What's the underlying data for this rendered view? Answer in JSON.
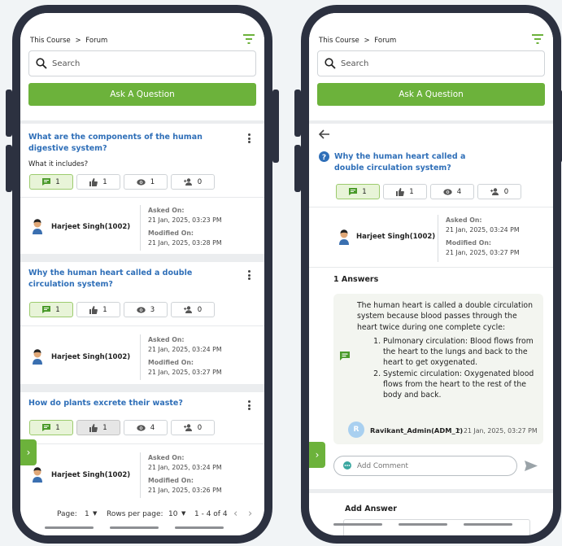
{
  "left": {
    "breadcrumb": {
      "course": "This Course",
      "separator": ">",
      "current": "Forum"
    },
    "search_placeholder": "Search",
    "ask_label": "Ask A Question",
    "questions": [
      {
        "title": "What are the components of the human digestive system?",
        "body": "What it includes?",
        "stats": {
          "answers": "1",
          "likes": "1",
          "views": "1",
          "followers": "0"
        },
        "author": "Harjeet Singh(1002)",
        "asked_label": "Asked On:",
        "asked": "21 Jan, 2025, 03:23 PM",
        "modified_label": "Modified On:",
        "modified": "21 Jan, 2025, 03:28 PM"
      },
      {
        "title": "Why the human heart called a double circulation system?",
        "stats": {
          "answers": "1",
          "likes": "1",
          "views": "3",
          "followers": "0"
        },
        "author": "Harjeet Singh(1002)",
        "asked_label": "Asked On:",
        "asked": "21 Jan, 2025, 03:24 PM",
        "modified_label": "Modified On:",
        "modified": "21 Jan, 2025, 03:27 PM"
      },
      {
        "title": "How do plants excrete their waste?",
        "stats": {
          "answers": "1",
          "likes": "1",
          "views": "4",
          "followers": "0"
        },
        "author": "Harjeet Singh(1002)",
        "asked_label": "Asked On:",
        "asked": "21 Jan, 2025, 03:24 PM",
        "modified_label": "Modified On:",
        "modified": "21 Jan, 2025, 03:26 PM"
      }
    ],
    "pagination": {
      "page_label": "Page:",
      "page": "1",
      "rows_label": "Rows per page:",
      "rows": "10",
      "range": "1 - 4 of 4"
    }
  },
  "right": {
    "breadcrumb": {
      "course": "This Course",
      "separator": ">",
      "current": "Forum"
    },
    "search_placeholder": "Search",
    "ask_label": "Ask A Question",
    "question": {
      "title": "Why the human heart called a double circulation system?",
      "stats": {
        "answers": "1",
        "likes": "1",
        "views": "4",
        "followers": "0"
      },
      "author": "Harjeet Singh(1002)",
      "asked_label": "Asked On:",
      "asked": "21 Jan, 2025, 03:24 PM",
      "modified_label": "Modified On:",
      "modified": "21 Jan, 2025, 03:27 PM"
    },
    "answers_heading": "1 Answers",
    "answer": {
      "intro": "The human heart is called a double circulation system because blood passes through the heart twice during one complete cycle:",
      "points": [
        "Pulmonary circulation: Blood flows from the heart to the lungs and back to the heart to get oxygenated.",
        "Systemic circulation: Oxygenated blood flows from the heart to the rest of the body and back."
      ],
      "author_initial": "R",
      "author": "Ravikant_Admin(ADM_1)",
      "bullet": "•",
      "date": "21 Jan, 2025, 03:27 PM"
    },
    "comment_placeholder": "Add Comment",
    "add_answer_label": "Add Answer"
  },
  "colors": {
    "accent_green": "#6cb23b",
    "link_blue": "#2f6fb8",
    "phone_frame": "#2c3140"
  },
  "icons": [
    "search-icon",
    "filter-icon",
    "kebab-menu-icon",
    "comment-icon",
    "thumbs-up-icon",
    "eye-icon",
    "followers-icon",
    "back-arrow-icon",
    "help-circle-icon",
    "send-icon",
    "chevron-right-icon",
    "chevron-left-icon",
    "dropdown-caret-icon"
  ]
}
